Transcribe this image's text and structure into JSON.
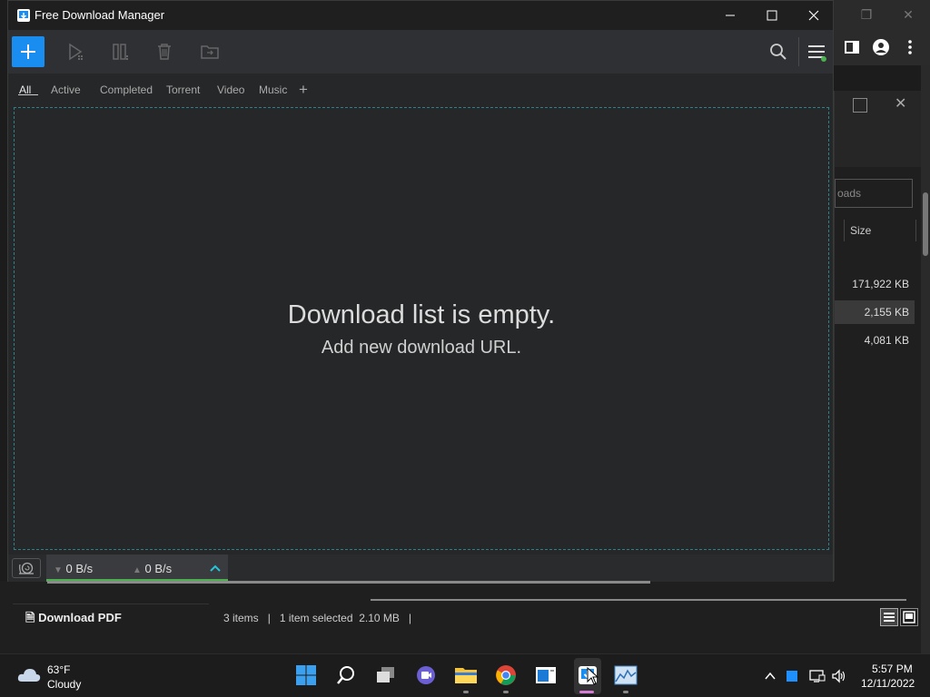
{
  "window": {
    "title": "Free Download Manager"
  },
  "tabs": [
    {
      "label": "All"
    },
    {
      "label": "Active"
    },
    {
      "label": "Completed"
    },
    {
      "label": "Torrent"
    },
    {
      "label": "Video"
    },
    {
      "label": "Music"
    }
  ],
  "empty_state": {
    "title": "Download list is empty.",
    "subtitle": "Add new download URL."
  },
  "status": {
    "download_speed": "0 B/s",
    "upload_speed": "0 B/s"
  },
  "background_explorer": {
    "search_placeholder_fragment": "oads",
    "size_column": "Size",
    "sizes": [
      "171,922 KB",
      "2,155 KB",
      "4,081 KB"
    ],
    "download_pdf": "Download PDF",
    "items_count": "3 items",
    "selection": "1 item selected  2.10 MB"
  },
  "taskbar": {
    "temperature": "63°F",
    "condition": "Cloudy",
    "time": "5:57 PM",
    "date": "12/11/2022"
  },
  "colors": {
    "accent": "#1a8ef0",
    "speed_bar": "#4caf50",
    "drop_border": "#2f7f86"
  }
}
